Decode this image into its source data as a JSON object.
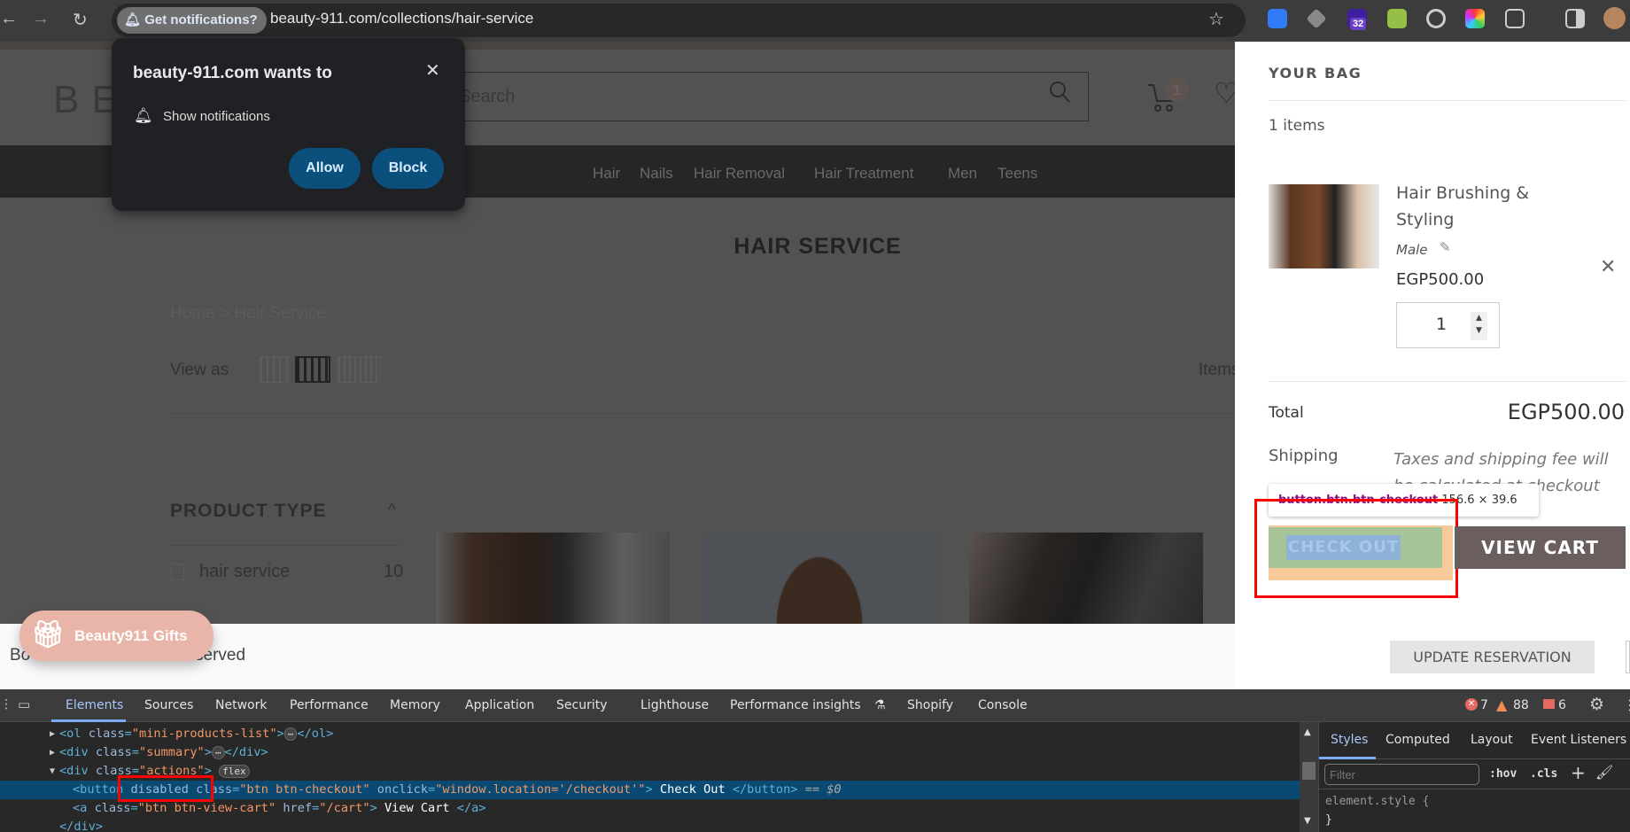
{
  "browser": {
    "url": "beauty-911.com/collections/hair-service",
    "chip": "Get notifications?",
    "ext_badge": "32"
  },
  "popup": {
    "title": "beauty-911.com wants to",
    "permission": "Show notifications",
    "allow": "Allow",
    "block": "Block"
  },
  "site": {
    "logo": "BE",
    "search_placeholder": "Search",
    "cart_count": "1",
    "nav": [
      "Hair",
      "Nails",
      "Hair Removal",
      "Hair Treatment",
      "Men",
      "Teens"
    ],
    "page_title": "HAIR SERVICE",
    "breadcrumb": {
      "home": "Home",
      "sep": ">",
      "current": "Hair Service"
    },
    "view_as": "View as",
    "items_label": "Items",
    "filter": {
      "title": "PRODUCT TYPE",
      "options": [
        {
          "label": "hair service",
          "count": "10"
        }
      ]
    },
    "footer": {
      "start": "Bo",
      "end": "served"
    },
    "gifts": "Beauty911 Gifts"
  },
  "cart": {
    "title": "YOUR BAG",
    "count_text": "1 items",
    "item": {
      "name_line1": "Hair Brushing &",
      "name_line2": "Styling",
      "variant": "Male",
      "price": "EGP500.00",
      "qty": "1"
    },
    "total_label": "Total",
    "total": "EGP500.00",
    "shipping_label": "Shipping",
    "shipping_note": "Taxes and shipping fee will be calculated at checkout",
    "checkout": "CHECK OUT",
    "view_cart": "VIEW CART",
    "update": "UPDATE RESERVATION",
    "inspect_selector": "button.btn.btn-checkout",
    "inspect_size": "156.6 × 39.6"
  },
  "devtools": {
    "tabs": [
      "Elements",
      "Sources",
      "Network",
      "Performance",
      "Memory",
      "Application",
      "Security",
      "Lighthouse",
      "Performance insights",
      "Shopify",
      "Console"
    ],
    "errors": "7",
    "warnings": "88",
    "issues": "6",
    "code": [
      {
        "arrow": "▶",
        "indent": 0,
        "seg": [
          [
            "tag",
            "<ol "
          ],
          [
            "attr",
            "class"
          ],
          [
            "tag",
            "="
          ],
          [
            "val",
            "\"mini-products-list\""
          ],
          [
            "tag",
            ">"
          ],
          [
            "ell",
            "⋯"
          ],
          [
            "tag",
            "</ol>"
          ]
        ]
      },
      {
        "arrow": "▶",
        "indent": 0,
        "seg": [
          [
            "tag",
            "<div "
          ],
          [
            "attr",
            "class"
          ],
          [
            "tag",
            "="
          ],
          [
            "val",
            "\"summary\""
          ],
          [
            "tag",
            ">"
          ],
          [
            "ell",
            "⋯"
          ],
          [
            "tag",
            "</div>"
          ]
        ]
      },
      {
        "arrow": "▼",
        "indent": 0,
        "seg": [
          [
            "tag",
            "<div "
          ],
          [
            "attr",
            "class"
          ],
          [
            "tag",
            "="
          ],
          [
            "val",
            "\"actions\""
          ],
          [
            "tag",
            "> "
          ],
          [
            "ell",
            "flex"
          ]
        ]
      },
      {
        "arrow": "",
        "indent": 1,
        "selected": true,
        "seg": [
          [
            "tag",
            "<button "
          ],
          [
            "attr",
            "disabled class"
          ],
          [
            "tag",
            "="
          ],
          [
            "val",
            "\"btn btn-checkout\""
          ],
          [
            "attr",
            " onclick"
          ],
          [
            "tag",
            "="
          ],
          [
            "val",
            "\"window.location='/checkout'\""
          ],
          [
            "tag",
            ">"
          ],
          [
            "txt",
            " Check Out "
          ],
          [
            "tag",
            "</button>"
          ],
          [
            "eq",
            " == $0"
          ]
        ]
      },
      {
        "arrow": "",
        "indent": 1,
        "seg": [
          [
            "tag",
            "<a "
          ],
          [
            "attr",
            "class"
          ],
          [
            "tag",
            "="
          ],
          [
            "val",
            "\"btn btn-view-cart\""
          ],
          [
            "attr",
            " href"
          ],
          [
            "tag",
            "="
          ],
          [
            "val",
            "\"/cart\""
          ],
          [
            "tag",
            ">"
          ],
          [
            "txt",
            " View Cart "
          ],
          [
            "tag",
            "</a>"
          ]
        ]
      },
      {
        "arrow": "",
        "indent": 0,
        "seg": [
          [
            "tag",
            "</div>"
          ]
        ]
      }
    ],
    "styles_tabs": [
      "Styles",
      "Computed",
      "Layout",
      "Event Listeners"
    ],
    "filter_placeholder": "Filter",
    "hov": ":hov",
    "cls": ".cls",
    "element_style": "element.style {",
    "close_brace": "}"
  }
}
